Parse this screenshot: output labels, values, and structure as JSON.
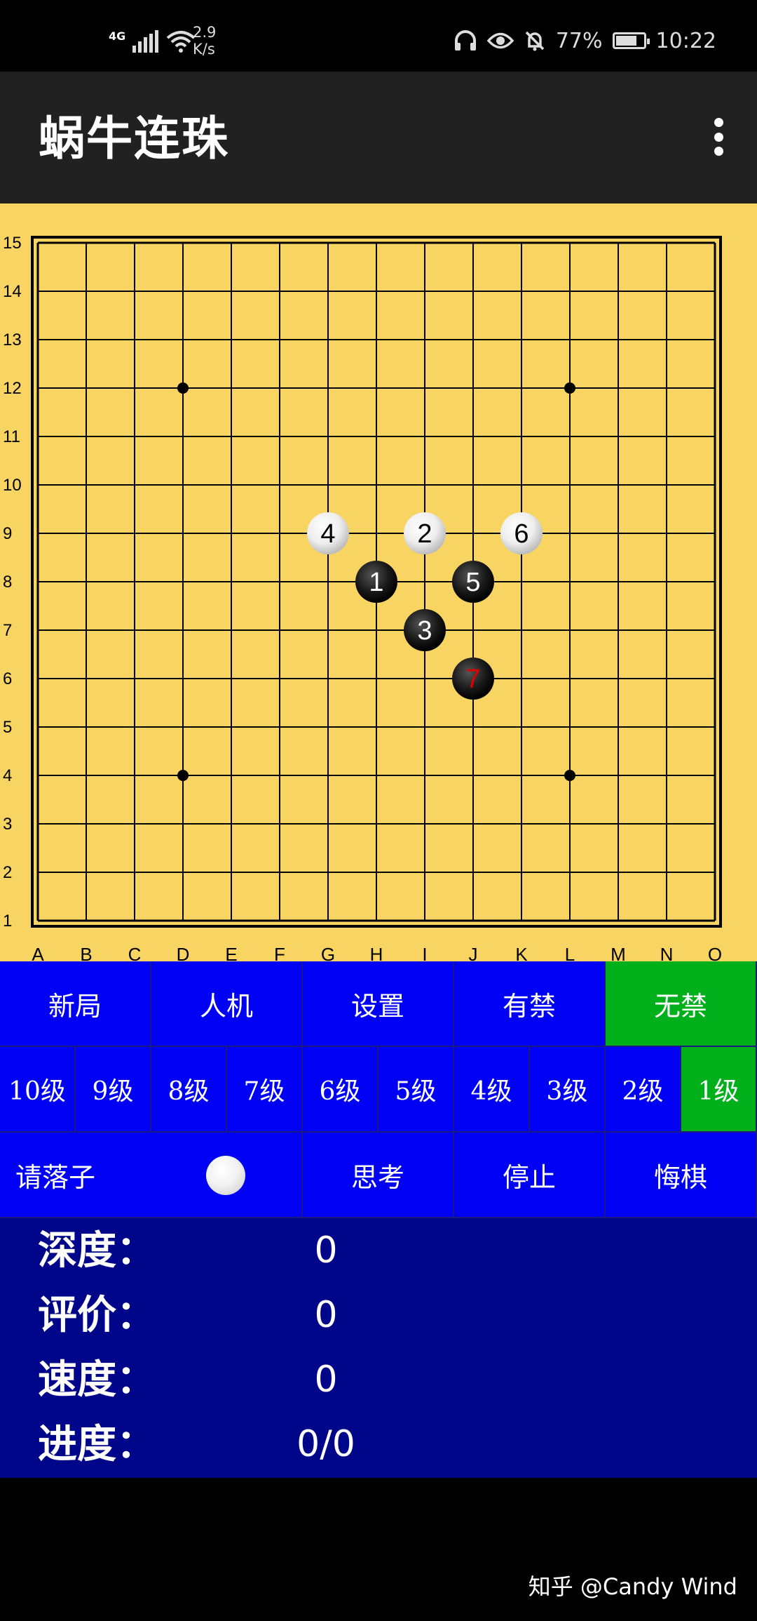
{
  "status_bar": {
    "network_type": "4G",
    "net_speed_value": "2.9",
    "net_speed_unit": "K/s",
    "battery_percent": "77%",
    "battery_level": 0.77,
    "time": "10:22",
    "icons": [
      "signal-icon",
      "wifi-icon",
      "headphones-icon",
      "eye-icon",
      "mute-bell-icon",
      "battery-icon"
    ]
  },
  "app_bar": {
    "title": "蜗牛连珠",
    "menu_icon": "more-vert-icon"
  },
  "board": {
    "size": 15,
    "columns": [
      "A",
      "B",
      "C",
      "D",
      "E",
      "F",
      "G",
      "H",
      "I",
      "J",
      "K",
      "L",
      "M",
      "N",
      "O"
    ],
    "rows": [
      "1",
      "2",
      "3",
      "4",
      "5",
      "6",
      "7",
      "8",
      "9",
      "10",
      "11",
      "12",
      "13",
      "14",
      "15"
    ],
    "star_points": [
      [
        "D",
        "4"
      ],
      [
        "L",
        "4"
      ],
      [
        "D",
        "12"
      ],
      [
        "L",
        "12"
      ]
    ],
    "colors": {
      "wood": "#f8d462",
      "line": "#000000",
      "last_move_number": "#e00000"
    },
    "stones": [
      {
        "move": "1",
        "col": "H",
        "row": "8",
        "color": "black"
      },
      {
        "move": "2",
        "col": "I",
        "row": "9",
        "color": "white"
      },
      {
        "move": "3",
        "col": "I",
        "row": "7",
        "color": "black"
      },
      {
        "move": "4",
        "col": "G",
        "row": "9",
        "color": "white"
      },
      {
        "move": "5",
        "col": "J",
        "row": "8",
        "color": "black"
      },
      {
        "move": "6",
        "col": "K",
        "row": "9",
        "color": "white"
      },
      {
        "move": "7",
        "col": "J",
        "row": "6",
        "color": "black",
        "last": true
      }
    ]
  },
  "controls": {
    "row1": [
      {
        "label": "新局",
        "active": false
      },
      {
        "label": "人机",
        "active": false
      },
      {
        "label": "设置",
        "active": false
      },
      {
        "label": "有禁",
        "active": false
      },
      {
        "label": "无禁",
        "active": true
      }
    ],
    "levels": [
      {
        "label": "10级",
        "active": false
      },
      {
        "label": "9级",
        "active": false
      },
      {
        "label": "8级",
        "active": false
      },
      {
        "label": "7级",
        "active": false
      },
      {
        "label": "6级",
        "active": false
      },
      {
        "label": "5级",
        "active": false
      },
      {
        "label": "4级",
        "active": false
      },
      {
        "label": "3级",
        "active": false
      },
      {
        "label": "2级",
        "active": false
      },
      {
        "label": "1级",
        "active": true
      }
    ],
    "prompt": "请落子",
    "turn_stone": "white",
    "think_label": "思考",
    "stop_label": "停止",
    "undo_label": "悔棋",
    "colors": {
      "panel": "#0000f5",
      "active": "#00b01a"
    }
  },
  "stats": {
    "depth_label": "深度：",
    "depth_value": "0",
    "eval_label": "评价：",
    "eval_value": "0",
    "speed_label": "速度：",
    "speed_value": "0",
    "progress_label": "进度：",
    "progress_value": "0/0",
    "background": "#00068a"
  },
  "watermark": "知乎 @Candy Wind"
}
